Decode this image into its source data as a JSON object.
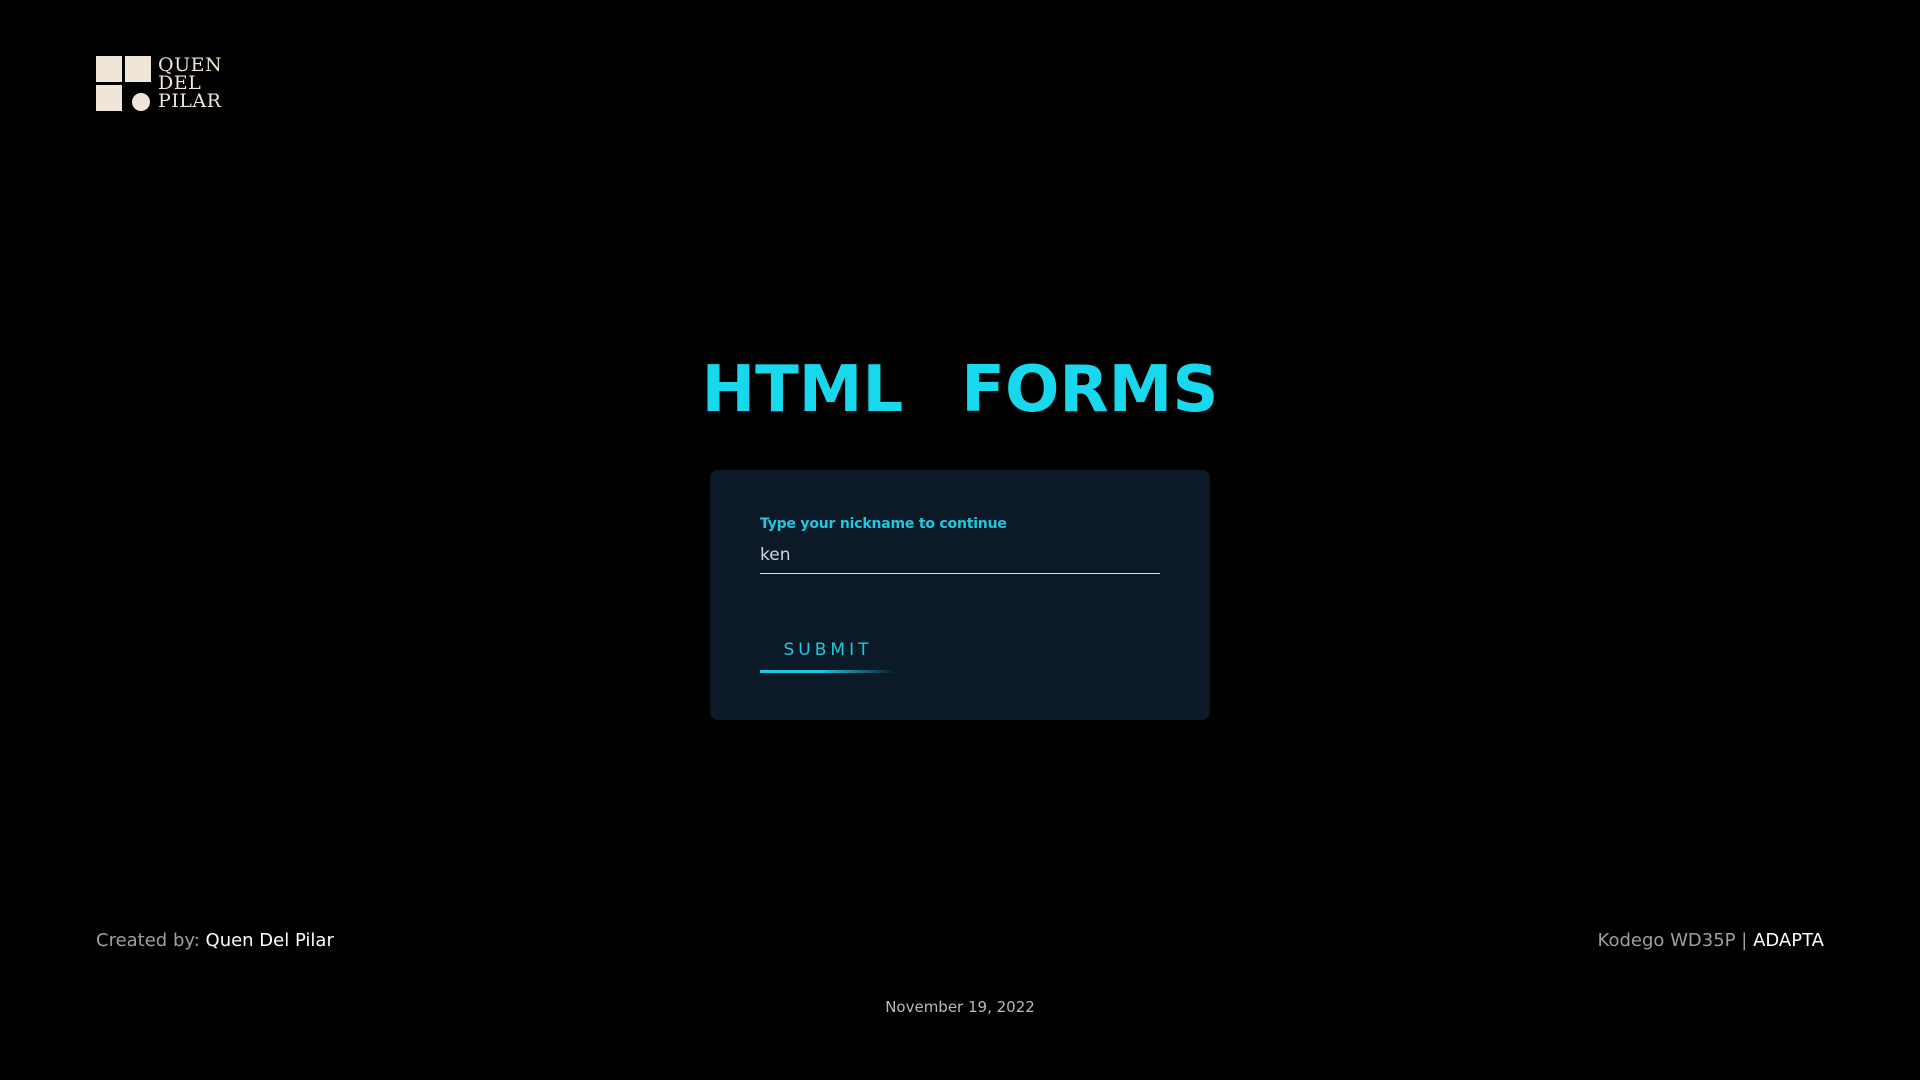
{
  "logo": {
    "line1": "QUEN",
    "line2": "DEL",
    "line3": "PILAR",
    "icon": "squares-and-circle-logo-icon",
    "color": "#efe5d9"
  },
  "title": {
    "word1": "HTML",
    "word2": "FORMS",
    "color": "#17d8ec"
  },
  "form": {
    "label": "Type your nickname to continue",
    "input_value": "ken",
    "submit_label": "SUBMIT",
    "card_color": "#0b1a26",
    "accent_color": "#1fc8e0"
  },
  "footer": {
    "created_prefix": "Created by:",
    "created_name": "Quen Del Pilar",
    "course": "Kodego WD35P |",
    "brand": "ADAPTA",
    "date": "November 19, 2022"
  }
}
